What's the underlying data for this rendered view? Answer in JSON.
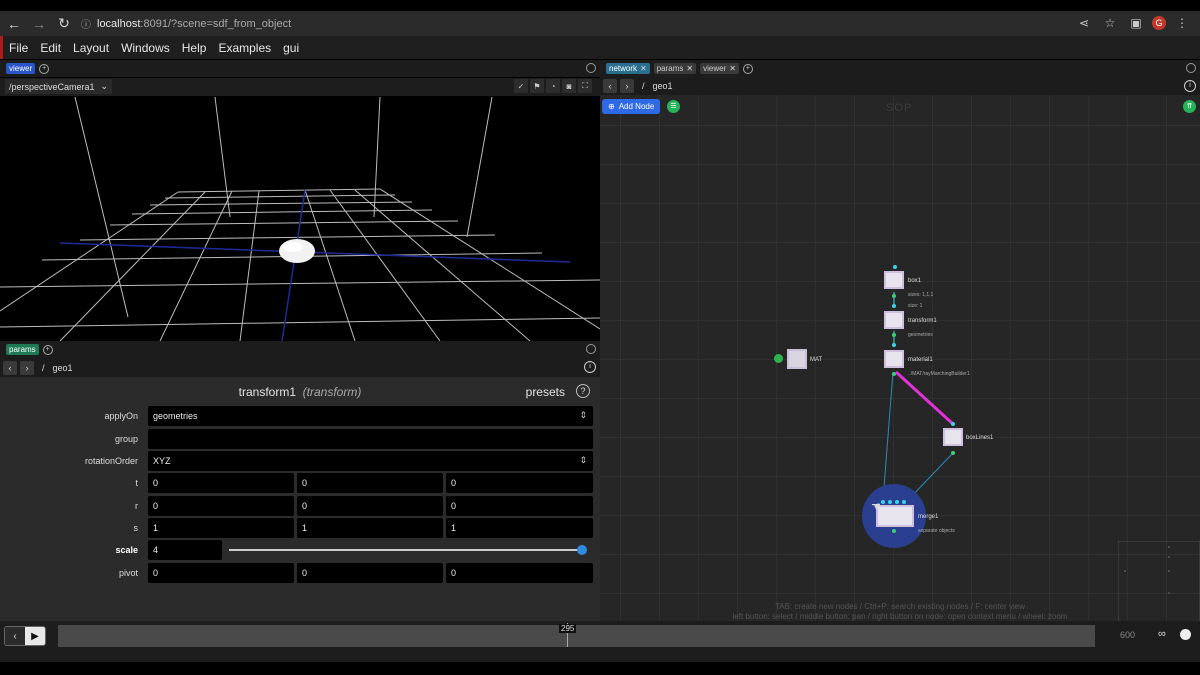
{
  "browser": {
    "url_host": "localhost",
    "url_rest": ":8091/?scene=sdf_from_object",
    "avatar_letter": "G",
    "icons": [
      "back-arrow-icon",
      "forward-arrow-icon",
      "reload-icon",
      "info-icon",
      "share-icon",
      "star-icon",
      "sidebar-icon",
      "profile-avatar",
      "kebab-menu-icon"
    ]
  },
  "menu": {
    "items": [
      "File",
      "Edit",
      "Layout",
      "Windows",
      "Help",
      "Examples",
      "gui"
    ]
  },
  "viewer_panel": {
    "tab": "viewer",
    "camera": "/perspectiveCamera1"
  },
  "params_panel": {
    "tab": "params",
    "path_root": "/",
    "path": "geo1",
    "node_name": "transform1",
    "node_type": "(transform)",
    "presets": "presets",
    "help": "?",
    "rows": {
      "applyOn": {
        "label": "applyOn",
        "value": "geometries"
      },
      "group": {
        "label": "group",
        "value": ""
      },
      "rotationOrder": {
        "label": "rotationOrder",
        "value": "XYZ"
      },
      "t": {
        "label": "t",
        "values": [
          "0",
          "0",
          "0"
        ]
      },
      "r": {
        "label": "r",
        "values": [
          "0",
          "0",
          "0"
        ]
      },
      "s": {
        "label": "s",
        "values": [
          "1",
          "1",
          "1"
        ]
      },
      "scale": {
        "label": "scale",
        "value": "4",
        "slider_fraction": 1.0
      },
      "pivot": {
        "label": "pivot",
        "values": [
          "0",
          "0",
          "0"
        ]
      }
    }
  },
  "network_panel": {
    "tabs": [
      "network",
      "params",
      "viewer"
    ],
    "path_root": "/",
    "path": "geo1",
    "add_node": "Add Node",
    "context": "SOP",
    "nodes": {
      "box1": {
        "name": "box1",
        "sub1": "sizes: 1,1,1",
        "sub2": "size: 1"
      },
      "transform1": {
        "name": "transform1",
        "sub": "geometries"
      },
      "material1": {
        "name": "material1",
        "sub": "../MAT/rayMarchingBuilder1"
      },
      "mat": {
        "name": "MAT"
      },
      "boxLines1": {
        "name": "boxLines1"
      },
      "merge1": {
        "name": "merge1",
        "sub": "separate objects"
      }
    },
    "help_line1": "TAB: create new nodes / Ctrl+P: search existing nodes / F: center view",
    "help_line2": "left button: select / middle button: pan / right button on node: open context menu / wheel: zoom"
  },
  "timeline": {
    "current_frame": "295",
    "end_frame": "600"
  },
  "colors": {
    "accent_blue": "#2e6ae6",
    "selection_magenta": "#e233d8",
    "node_fill": "#e8e4ee",
    "merge_halo": "#2a3f8f"
  }
}
